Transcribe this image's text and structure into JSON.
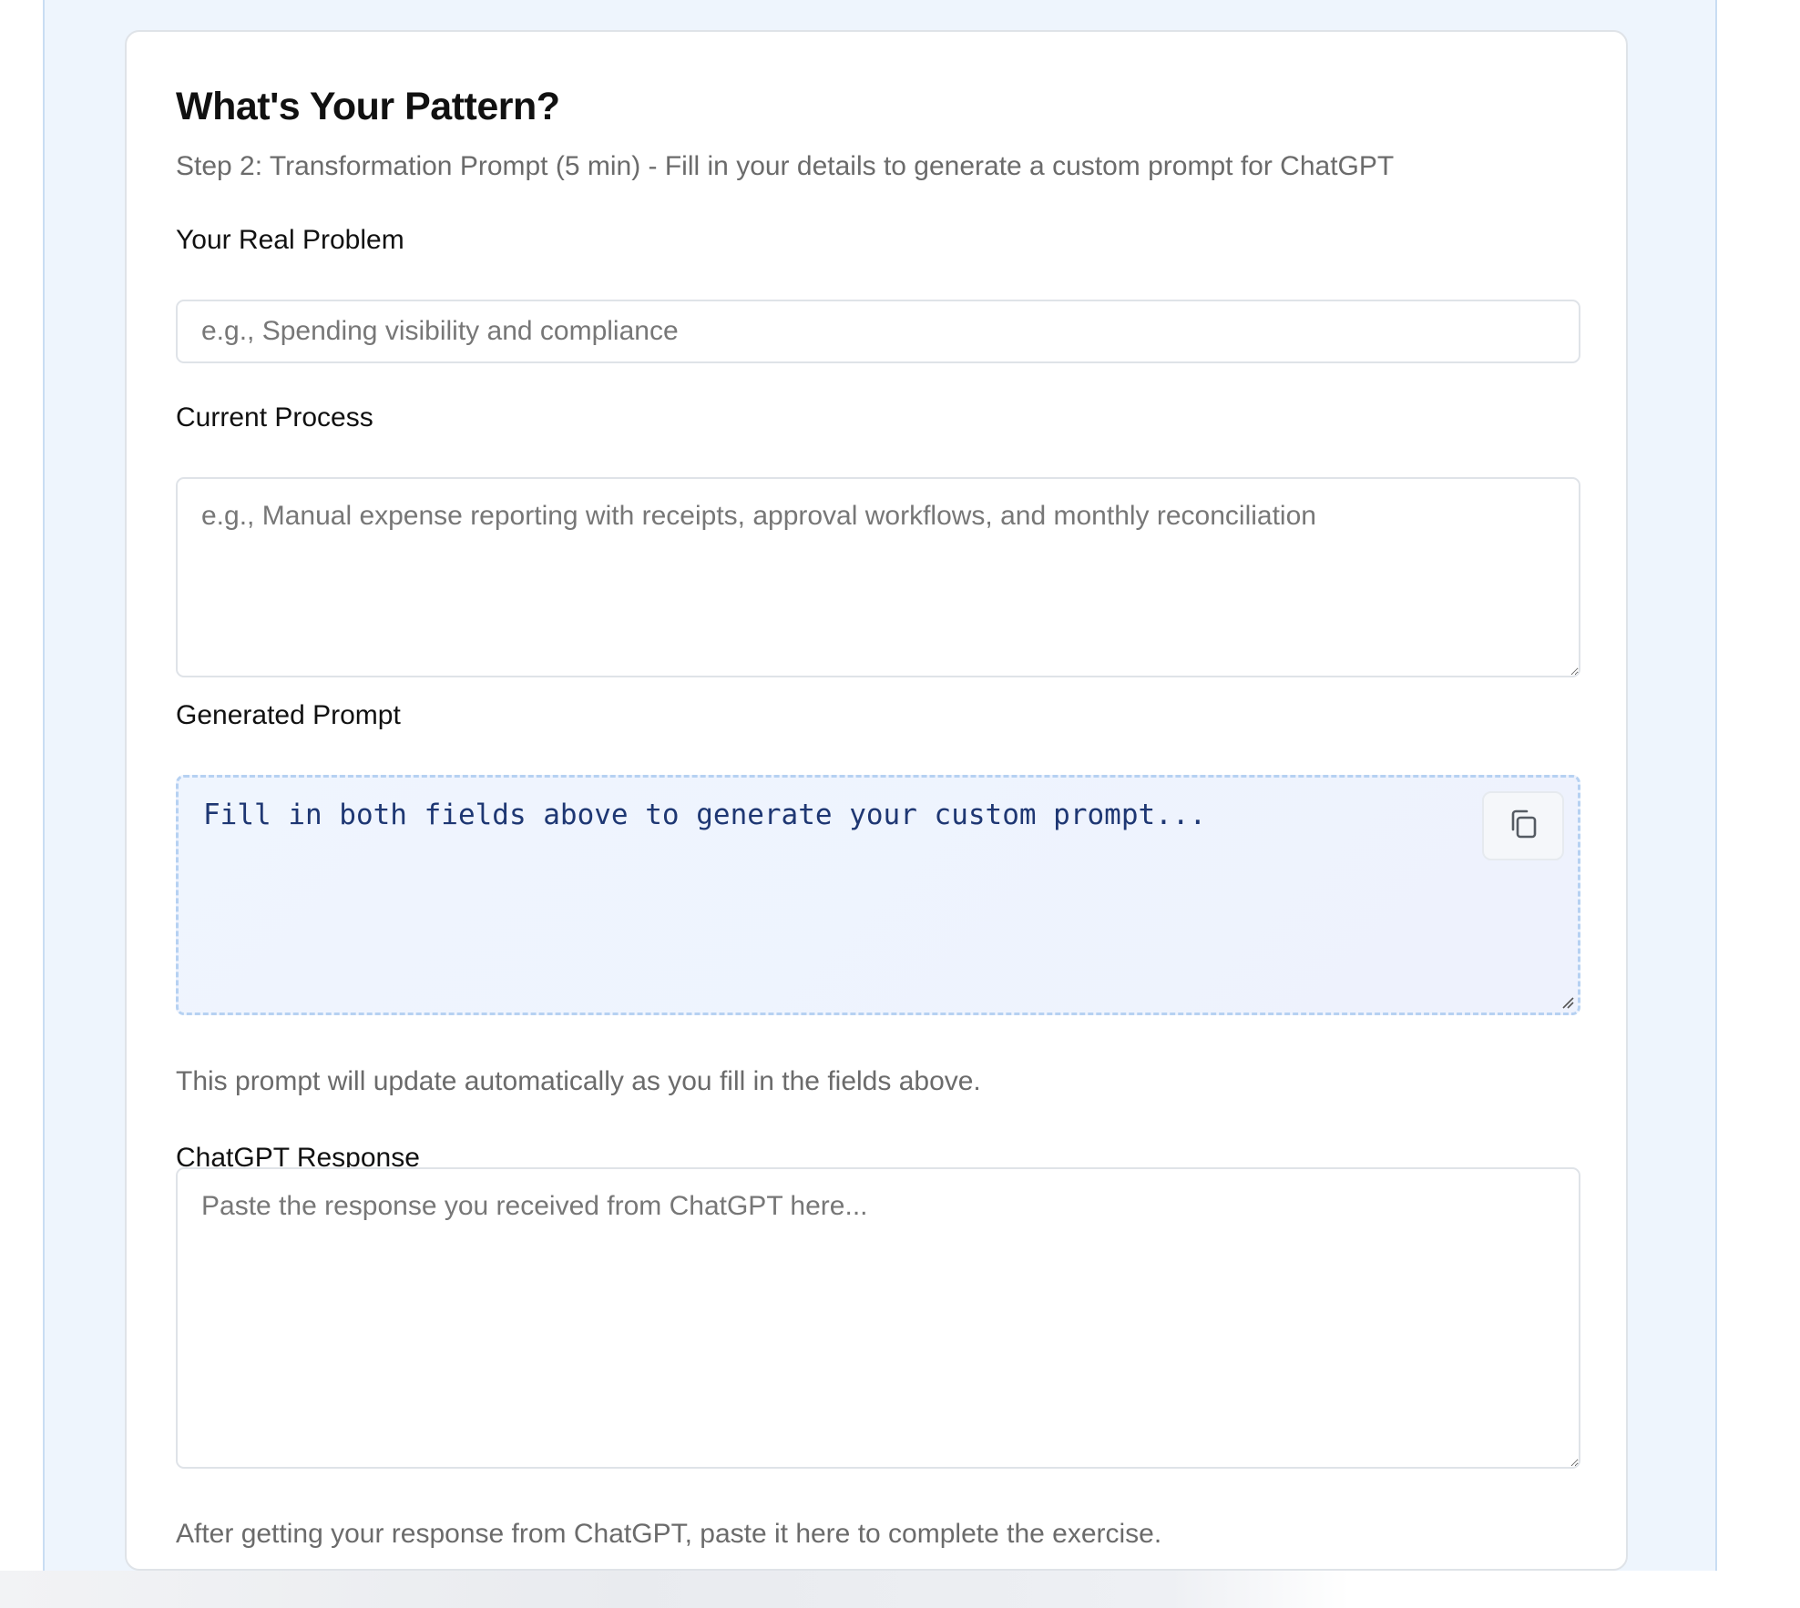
{
  "card": {
    "title": "What's Your Pattern?",
    "subtitle": "Step 2: Transformation Prompt (5 min) - Fill in your details to generate a custom prompt for ChatGPT"
  },
  "problem": {
    "label": "Your Real Problem",
    "value": "",
    "placeholder": "e.g., Spending visibility and compliance"
  },
  "process": {
    "label": "Current Process",
    "value": "",
    "placeholder": "e.g., Manual expense reporting with receipts, approval workflows, and monthly reconciliation"
  },
  "generated": {
    "label": "Generated Prompt",
    "text": "Fill in both fields above to generate your custom prompt...",
    "copy_icon": "copy-icon",
    "helper": "This prompt will update automatically as you fill in the fields above."
  },
  "response": {
    "label": "ChatGPT Response",
    "value": "",
    "placeholder": "Paste the response you received from ChatGPT here...",
    "helper": "After getting your response from ChatGPT, paste it here to complete the exercise."
  },
  "colors": {
    "page_background": "#eef5fd",
    "prompt_background": "#eff5fe",
    "prompt_border": "#b6d1f2",
    "prompt_text": "#1e3773",
    "muted_text": "#6b6b6b"
  }
}
